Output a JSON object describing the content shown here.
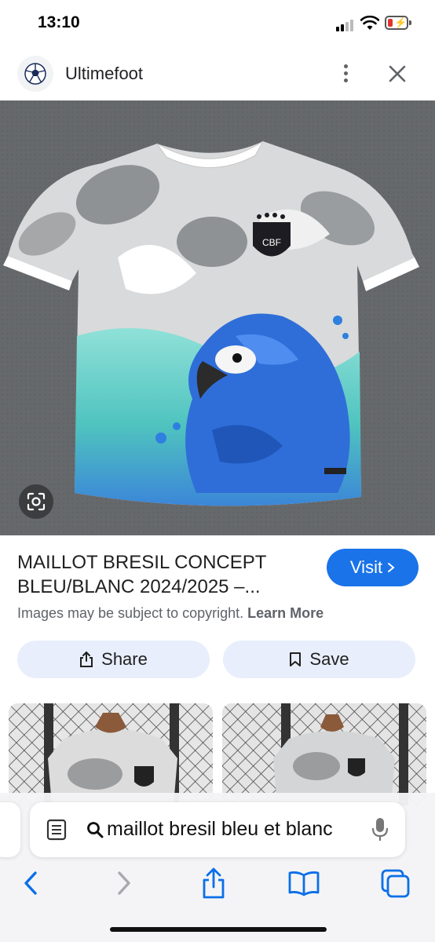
{
  "status_bar": {
    "time": "13:10",
    "battery_color": "#e0332b"
  },
  "site": {
    "name": "Ultimefoot",
    "favicon": "soccer-ball-icon"
  },
  "header_icons": {
    "more": "more-vert-icon",
    "close": "close-icon"
  },
  "image": {
    "alt": "",
    "lens_icon": "lens-icon"
  },
  "result": {
    "title_line1": "MAILLOT BRESIL CONCEPT",
    "title_line2": "BLEU/BLANC 2024/2025 –...",
    "visit_label": "Visit",
    "copyright_text": "Images may be subject to copyright.",
    "learn_more": "Learn More"
  },
  "actions": {
    "share_label": "Share",
    "save_label": "Save"
  },
  "browser": {
    "address_text": "maillot bresil bleu et blanc",
    "toolbar_icons": [
      "back-icon",
      "forward-icon",
      "share-icon",
      "bookmarks-icon",
      "tabs-icon"
    ]
  },
  "colors": {
    "accent": "#1a73e8",
    "pill_bg": "#e8eefb",
    "text_secondary": "#5f6368"
  }
}
